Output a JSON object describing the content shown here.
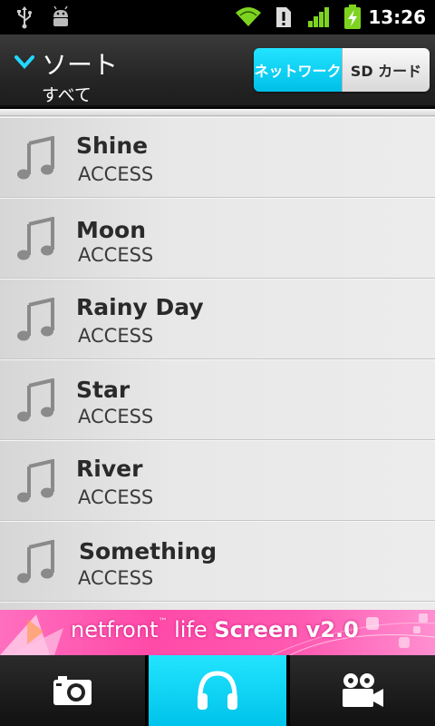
{
  "status_bar": {
    "time": "13:26",
    "icons": [
      "usb-icon",
      "android-debug-icon",
      "wifi-icon",
      "alert-icon",
      "signal-icon",
      "battery-charging-icon"
    ]
  },
  "header": {
    "sort_label": "ソート",
    "sort_value": "すべて",
    "toggle": {
      "network_label": "ネットワーク",
      "sd_label": "SD カード",
      "selected": "network"
    }
  },
  "tracks": [
    {
      "title": "Shine",
      "artist": "ACCESS"
    },
    {
      "title": "Moon",
      "artist": "ACCESS"
    },
    {
      "title": "Rainy Day",
      "artist": "ACCESS"
    },
    {
      "title": "Star",
      "artist": "ACCESS"
    },
    {
      "title": "River",
      "artist": "ACCESS"
    },
    {
      "title": "Something",
      "artist": "ACCESS"
    }
  ],
  "banner": {
    "brand": "netfront",
    "brand_sup": "™",
    "brand2": "life",
    "product": "Screen v2.0"
  },
  "tabs": [
    {
      "icon": "camera-icon",
      "selected": false
    },
    {
      "icon": "headphones-icon",
      "selected": true
    },
    {
      "icon": "video-camera-icon",
      "selected": false
    }
  ],
  "colors": {
    "accent": "#00c8f0",
    "banner_pink": "#ff4aa8"
  }
}
